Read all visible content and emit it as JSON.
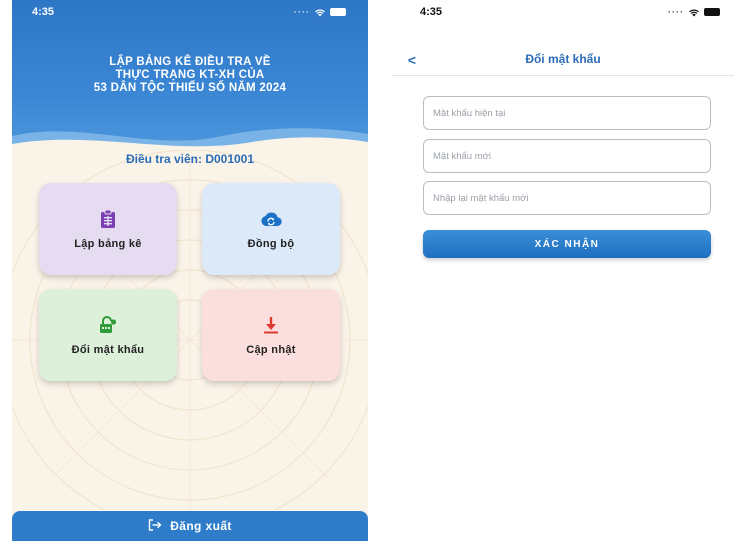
{
  "left_screen": {
    "status": {
      "time": "4:35"
    },
    "title_lines": [
      "LẬP BẢNG KÊ ĐIỀU TRA VỀ",
      "THỰC TRẠNG KT-XH CỦA",
      "53 DÂN TỘC THIỂU SỐ NĂM 2024"
    ],
    "interviewer": "Điều tra viên: D001001",
    "tiles": [
      {
        "label": "Lập bảng kê",
        "icon": "clipboard-icon",
        "color": "#e6dcf2"
      },
      {
        "label": "Đồng bộ",
        "icon": "cloud-sync-icon",
        "color": "#dbe9f8"
      },
      {
        "label": "Đổi mật khẩu",
        "icon": "lock-icon",
        "color": "#dcf0da"
      },
      {
        "label": "Cập nhật",
        "icon": "download-icon",
        "color": "#fbdede"
      }
    ],
    "logout": {
      "label": "Đăng xuất",
      "icon": "logout-icon"
    }
  },
  "right_screen": {
    "status": {
      "time": "4:35"
    },
    "nav": {
      "back_label": "<",
      "title": "Đổi mật khẩu"
    },
    "fields": [
      {
        "placeholder": "Mật khẩu hiện tại",
        "value": ""
      },
      {
        "placeholder": "Mật khẩu mới",
        "value": ""
      },
      {
        "placeholder": "Nhập lại mật khẩu mới",
        "value": ""
      }
    ],
    "confirm_label": "XÁC NHẬN"
  },
  "colors": {
    "primary_blue": "#2e76c6",
    "title_blue": "#2b6cb8",
    "tile_purple": "#e6dcf2",
    "tile_blue": "#dbe9f8",
    "tile_green": "#dcf0da",
    "tile_red": "#fbdede"
  }
}
